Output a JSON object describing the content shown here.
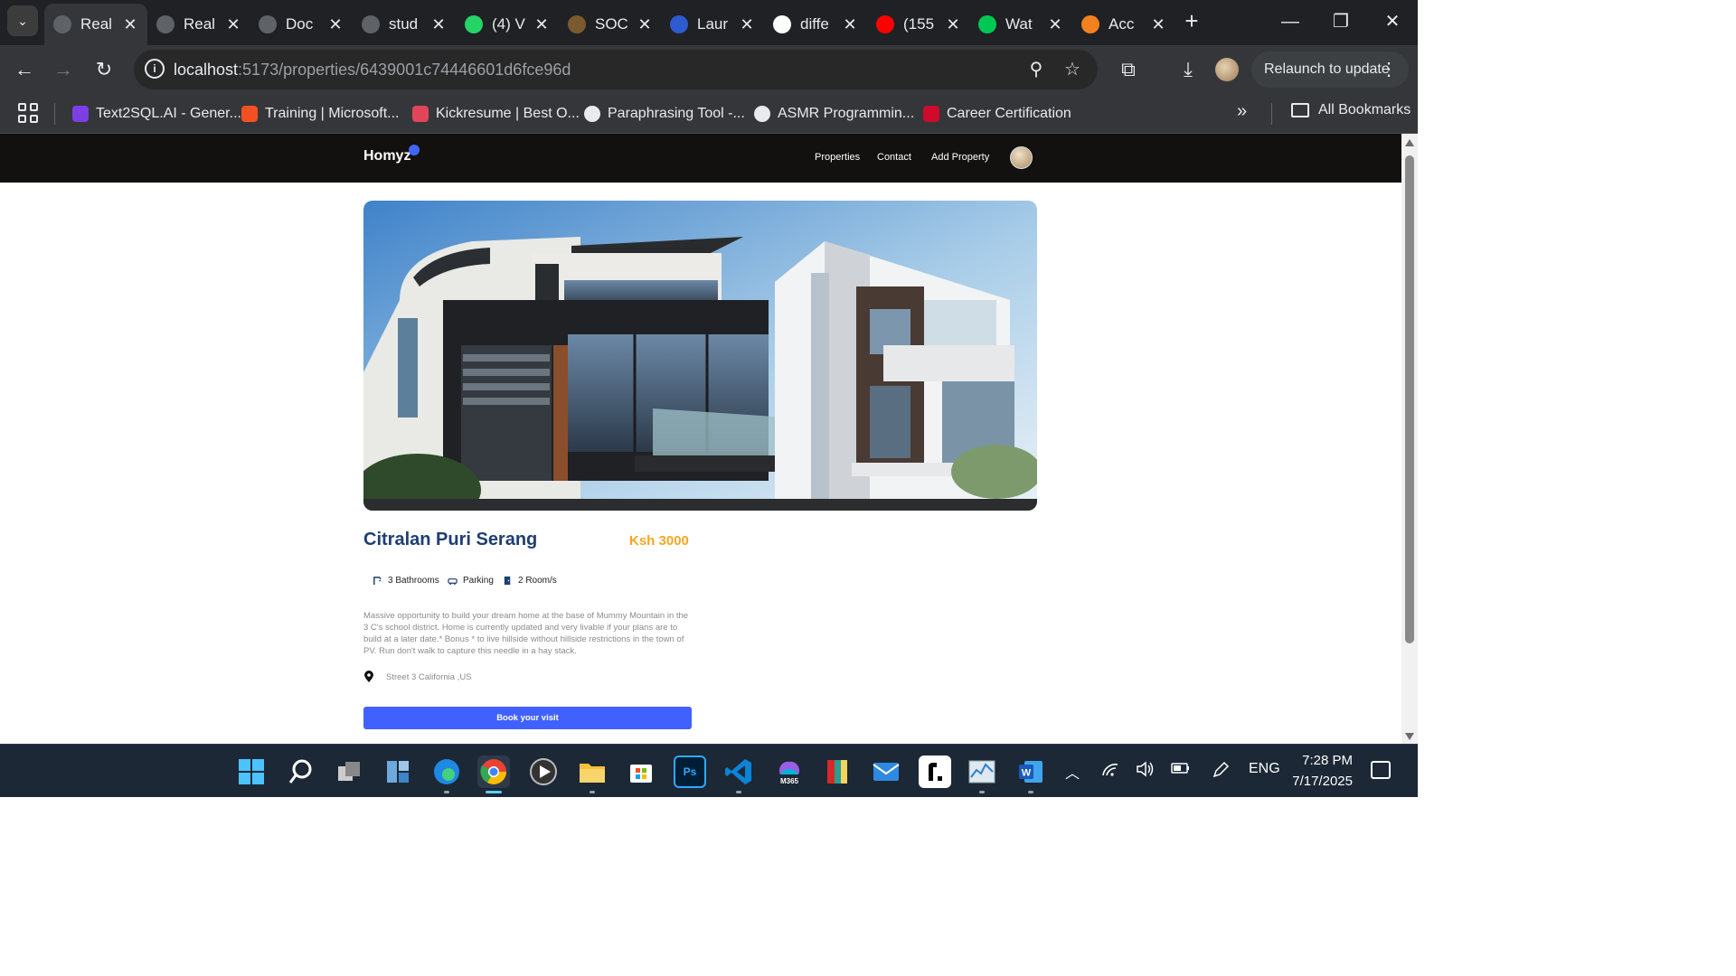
{
  "browser": {
    "tabs": [
      {
        "label": "Real",
        "close": "✕",
        "icon": "globe-icon",
        "color": "#5f6368",
        "active": true
      },
      {
        "label": "Real",
        "close": "✕",
        "icon": "globe-icon",
        "color": "#5f6368"
      },
      {
        "label": "Doc",
        "close": "✕",
        "icon": "openai-icon",
        "color": "#5f6368"
      },
      {
        "label": "stud",
        "close": "✕",
        "icon": "globe-icon",
        "color": "#5f6368"
      },
      {
        "label": "(4) V",
        "close": "✕",
        "icon": "whatsapp-icon",
        "color": "#25d366"
      },
      {
        "label": "SOC",
        "close": "✕",
        "icon": "soc-icon",
        "color": "#7a5a2e"
      },
      {
        "label": "Laur",
        "close": "✕",
        "icon": "zoom-icon",
        "color": "#2d5bd0"
      },
      {
        "label": "diffe",
        "close": "✕",
        "icon": "google-icon",
        "color": "#ffffff"
      },
      {
        "label": "(155",
        "close": "✕",
        "icon": "youtube-icon",
        "color": "#ff0000"
      },
      {
        "label": "Wat",
        "close": "✕",
        "icon": "play-icon",
        "color": "#00c853"
      },
      {
        "label": "Acc",
        "close": "✕",
        "icon": "cloudflare-icon",
        "color": "#f48120"
      }
    ],
    "url_host": "localhost",
    "url_path": ":5173/properties/6439001c74446601d6fce96d",
    "relaunch_label": "Relaunch to update",
    "bookmarks": [
      {
        "label": "Text2SQL.AI - Gener...",
        "color": "#7b3fe4"
      },
      {
        "label": "Training | Microsoft...",
        "color": "#f25022"
      },
      {
        "label": "Kickresume | Best O...",
        "color": "#e0455a"
      },
      {
        "label": "Paraphrasing Tool -...",
        "color": "#e8eaed"
      },
      {
        "label": "ASMR Programmin...",
        "color": "#e8eaed"
      },
      {
        "label": "Career Certification",
        "color": "#cf0a2c"
      }
    ],
    "all_bookmarks_label": "All Bookmarks"
  },
  "site": {
    "logo": "Homyz",
    "accent": "#4066ff",
    "nav": [
      "Properties",
      "Contact",
      "Add Property"
    ]
  },
  "property": {
    "title": "Citralan Puri Serang",
    "price": "Ksh 3000",
    "facilities": [
      {
        "label": "3 Bathrooms",
        "icon": "shower-icon"
      },
      {
        "label": "Parking",
        "icon": "car-icon"
      },
      {
        "label": "2 Room/s",
        "icon": "door-icon"
      }
    ],
    "description": "Massive opportunity to build your dream home at the base of Mummy Mountain in the 3 C's school district. Home is currently updated and very livable if your plans are to build at a later date.* Bonus * to live hillside without hillside restrictions in the town of PV. Run don't walk to capture this needle in a hay stack.",
    "address": "Street 3 California ,US",
    "book_button": "Book your visit",
    "title_color": "#1f3e72",
    "price_color": "#f5a623",
    "button_color": "#4161ff"
  },
  "taskbar": {
    "apps": [
      "start",
      "search",
      "task-view",
      "widgets",
      "edge",
      "chrome",
      "media-player",
      "file-explorer",
      "microsoft-store",
      "photoshop",
      "vscode",
      "m365",
      "winrar",
      "mail",
      "roblox-studio",
      "task-manager",
      "word"
    ],
    "m365_label": "M365",
    "language": "ENG",
    "time": "7:28 PM",
    "date": "7/17/2025"
  }
}
